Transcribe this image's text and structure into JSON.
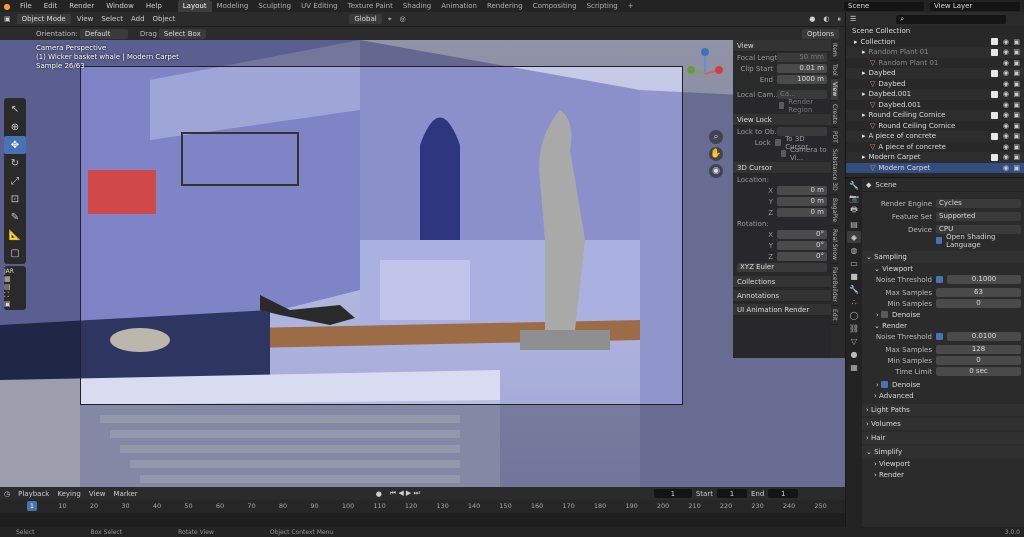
{
  "topbar": {
    "menus": [
      "File",
      "Edit",
      "Render",
      "Window",
      "Help"
    ],
    "workspaces": [
      "Layout",
      "Modeling",
      "Sculpting",
      "UV Editing",
      "Texture Paint",
      "Shading",
      "Animation",
      "Rendering",
      "Compositing",
      "Scripting"
    ],
    "active_workspace": "Layout",
    "scene": "Scene",
    "view_layer": "View Layer"
  },
  "viewport_header": {
    "mode": "Object Mode",
    "menus": [
      "View",
      "Select",
      "Add",
      "Object"
    ],
    "transform": "Global"
  },
  "tool_header": {
    "orientation_label": "Orientation:",
    "orientation_value": "Default",
    "drag_label": "Drag",
    "drag_value": "Select Box",
    "options": "Options"
  },
  "overlay": {
    "line1": "Camera Perspective",
    "line2": "(1) Wicker basket whale | Modern Carpet",
    "line3": "Sample 26/63"
  },
  "npanel": {
    "view_title": "View",
    "focal_length_label": "Focal Lengt",
    "focal_length": "50 mm",
    "clip_start_label": "Clip Start",
    "clip_start": "0.01 m",
    "end_label": "End",
    "clip_end": "1000 m",
    "local_camera_label": "Local Cam...",
    "local_camera_value": "Ca...",
    "render_region": "Render Region",
    "view_lock_title": "View Lock",
    "lock_to_object_label": "Lock to Ob...",
    "lock_label": "Lock",
    "to_3d_cursor": "To 3D Cursor",
    "camera_to_view": "Camera to Vi...",
    "cursor_title": "3D Cursor",
    "location_label": "Location:",
    "rotation_label": "Rotation:",
    "axes": [
      "X",
      "Y",
      "Z"
    ],
    "loc_values": [
      "0 m",
      "0 m",
      "0 m"
    ],
    "rot_values": [
      "0°",
      "0°",
      "0°"
    ],
    "rotation_mode": "XYZ Euler",
    "collections": "Collections",
    "annotations": "Annotations",
    "ui_anim": "UI Animation Render",
    "tabs": [
      "Item",
      "Tool",
      "View",
      "Create",
      "PDT",
      "Substance 3D",
      "BagaPie",
      "Real Snow",
      "FaceBuilder",
      "Edit"
    ]
  },
  "timeline": {
    "menus": [
      "Playback",
      "Keying",
      "View",
      "Marker"
    ],
    "current_frame": "1",
    "start_label": "Start",
    "start": "1",
    "end_label": "End",
    "end": "1",
    "ruler": [
      "1",
      "10",
      "20",
      "30",
      "40",
      "50",
      "60",
      "70",
      "80",
      "90",
      "100",
      "110",
      "120",
      "130",
      "140",
      "150",
      "160",
      "170",
      "180",
      "190",
      "200",
      "210",
      "220",
      "230",
      "240",
      "250"
    ]
  },
  "statusbar": {
    "items": [
      "Select",
      "Box Select",
      "Rotate View",
      "Object Context Menu"
    ],
    "version": "3.0.0"
  },
  "outliner": {
    "root": "Scene Collection",
    "rows": [
      {
        "label": "Collection",
        "indent": 1,
        "kind": "coll"
      },
      {
        "label": "Random Plant 01",
        "indent": 2,
        "kind": "coll",
        "muted": true
      },
      {
        "label": "Random Plant 01",
        "indent": 3,
        "kind": "obj",
        "muted": true
      },
      {
        "label": "Daybed",
        "indent": 2,
        "kind": "coll"
      },
      {
        "label": "Daybed",
        "indent": 3,
        "kind": "obj"
      },
      {
        "label": "Daybed.001",
        "indent": 2,
        "kind": "coll"
      },
      {
        "label": "Daybed.001",
        "indent": 3,
        "kind": "obj"
      },
      {
        "label": "Round Ceiling Cornice",
        "indent": 2,
        "kind": "coll"
      },
      {
        "label": "Round Ceiling Cornice",
        "indent": 3,
        "kind": "obj"
      },
      {
        "label": "A piece of concrete",
        "indent": 2,
        "kind": "coll"
      },
      {
        "label": "A piece of concrete",
        "indent": 3,
        "kind": "obj"
      },
      {
        "label": "Modern Carpet",
        "indent": 2,
        "kind": "coll"
      },
      {
        "label": "Modern Carpet",
        "indent": 3,
        "kind": "obj",
        "selected": true
      }
    ]
  },
  "properties": {
    "context": "Scene",
    "render_engine_label": "Render Engine",
    "render_engine": "Cycles",
    "feature_set_label": "Feature Set",
    "feature_set": "Supported",
    "device_label": "Device",
    "device": "CPU",
    "osl": "Open Shading Language",
    "sampling": "Sampling",
    "viewport": "Viewport",
    "noise_threshold_label": "Noise Threshold",
    "vp_noise": "0.1000",
    "max_samples_label": "Max Samples",
    "vp_max": "63",
    "min_samples_label": "Min Samples",
    "vp_min": "0",
    "denoise": "Denoise",
    "render": "Render",
    "r_noise": "0.0100",
    "r_max": "128",
    "r_min": "0",
    "time_limit_label": "Time Limit",
    "r_time": "0 sec",
    "advanced": "Advanced",
    "light_paths": "Light Paths",
    "volumes": "Volumes",
    "hair": "Hair",
    "simplify": "Simplify",
    "simplify_viewport": "Viewport",
    "simplify_render": "Render"
  }
}
